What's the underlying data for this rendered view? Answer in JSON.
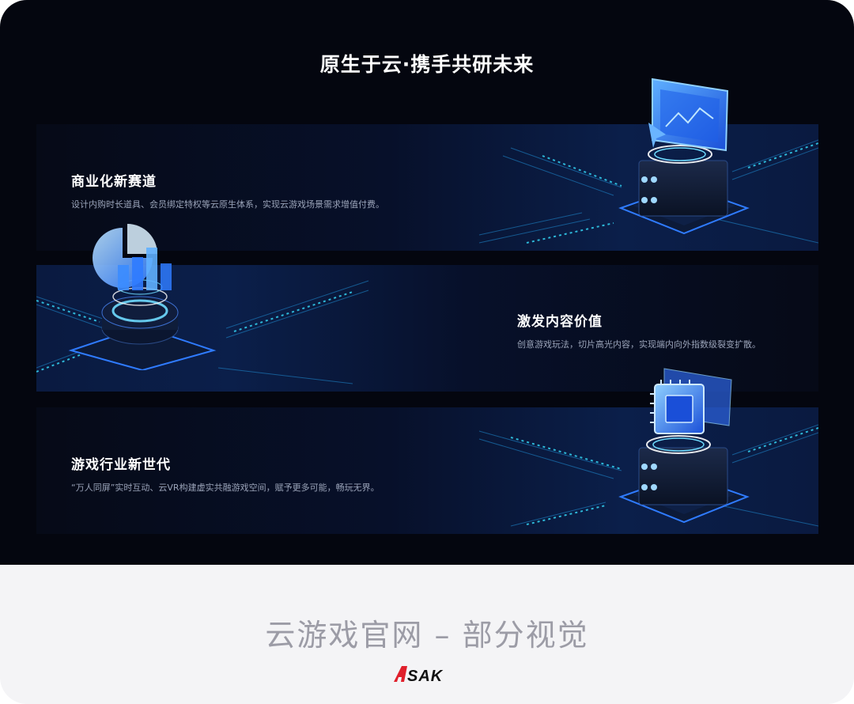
{
  "headline": "原生于云·携手共研未来",
  "sections": [
    {
      "title": "商业化新赛道",
      "desc": "设计内购时长道具、会员绑定特权等云原生体系，实现云游戏场景需求增值付费。",
      "icon": "server-monitor-icon"
    },
    {
      "title": "激发内容价值",
      "desc": "创意游戏玩法，切片高光内容，实现端内向外指数级裂变扩散。",
      "icon": "analytics-chart-icon"
    },
    {
      "title": "游戏行业新世代",
      "desc": "“万人同屏”实时互动、云VR构建虚实共融游戏空间，赋予更多可能，畅玩无界。",
      "icon": "server-chip-icon"
    }
  ],
  "footer": {
    "caption": "云游戏官网 – 部分视觉",
    "logo": "ASAK"
  },
  "colors": {
    "background": "#04060f",
    "accent": "#2f7bff",
    "glow": "#36e0ff",
    "footer_bg": "#f4f4f6",
    "logo_red": "#e0202c"
  }
}
